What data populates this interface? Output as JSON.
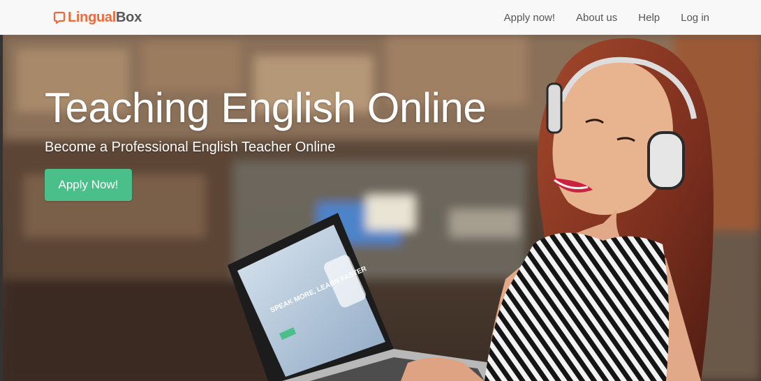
{
  "brand": {
    "part1": "Lingual",
    "part2": "Box",
    "icon": "speech-bubble-logo-icon"
  },
  "nav": {
    "items": [
      {
        "label": "Apply now!"
      },
      {
        "label": "About us"
      },
      {
        "label": "Help"
      },
      {
        "label": "Log in"
      }
    ]
  },
  "hero": {
    "title": "Teaching English Online",
    "subtitle": "Become a Professional English Teacher Online",
    "cta_label": "Apply Now!",
    "image": "woman-with-headphones-laptop-photo"
  },
  "laptop_screen": {
    "headline": "SPEAK MORE, LEARN FASTER"
  },
  "colors": {
    "brand_orange": "#ef6a3b",
    "brand_gray": "#585858",
    "cta_green": "#4bbf8a",
    "navbar_bg": "#f8f8f8"
  }
}
